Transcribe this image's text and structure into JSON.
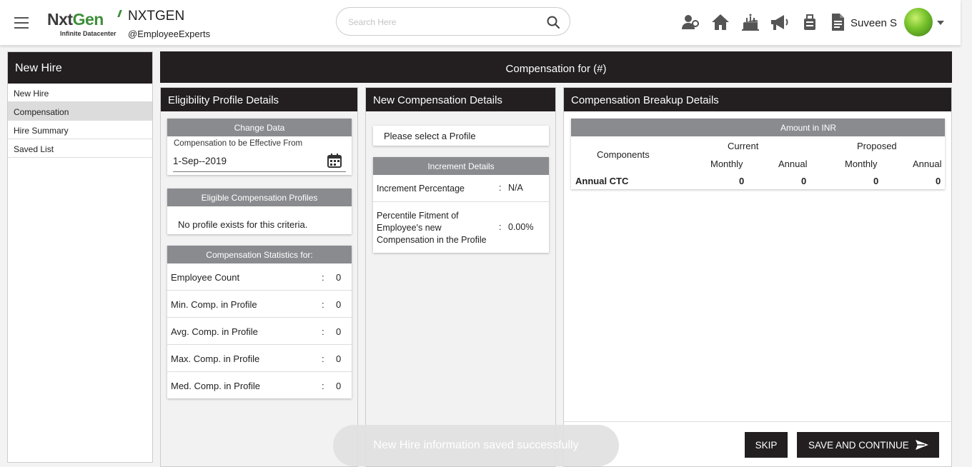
{
  "header": {
    "brand_main": "NxtGen",
    "brand_sub": "Infinite Datacenter",
    "company": "NXTGEN",
    "handle": "@EmployeeExperts",
    "search_placeholder": "Search Here",
    "username": "Suveen S"
  },
  "sidebar": {
    "title": "New Hire",
    "items": [
      {
        "label": "New Hire",
        "active": false
      },
      {
        "label": "Compensation",
        "active": true
      },
      {
        "label": "Hire Summary",
        "active": false
      },
      {
        "label": "Saved List",
        "active": false
      }
    ]
  },
  "main": {
    "title": "Compensation for (#)"
  },
  "eligibility": {
    "title": "Eligibility Profile Details",
    "change_data": {
      "header": "Change Data",
      "label": "Compensation to be Effective From",
      "date": "1-Sep--2019"
    },
    "profiles": {
      "header": "Eligible Compensation Profiles",
      "message": "No profile exists for this criteria."
    },
    "stats": {
      "header": "Compensation Statistics for:",
      "rows": [
        {
          "label": "Employee Count",
          "value": "0"
        },
        {
          "label": "Min. Comp. in Profile",
          "value": "0"
        },
        {
          "label": "Avg. Comp. in Profile",
          "value": "0"
        },
        {
          "label": "Max. Comp. in Profile",
          "value": "0"
        },
        {
          "label": "Med. Comp. in Profile",
          "value": "0"
        }
      ]
    }
  },
  "new_comp": {
    "title": "New Compensation Details",
    "profile_prompt": "Please select a Profile",
    "increment": {
      "header": "Increment Details",
      "rows": [
        {
          "label": "Increment Percentage",
          "value": "N/A"
        },
        {
          "label": "Percentile Fitment of Employee's new Compensation in the Profile",
          "value": "0.00%"
        }
      ],
      "row2_lines": [
        "Percentile Fitment of",
        "Employee's new",
        "Compensation in the Profile"
      ]
    }
  },
  "breakup": {
    "title": "Compensation Breakup Details",
    "amount_header": "Amount in INR",
    "components_label": "Components",
    "current_label": "Current",
    "proposed_label": "Proposed",
    "monthly_label": "Monthly",
    "annual_label": "Annual",
    "rows": [
      {
        "name": "Annual CTC",
        "current_monthly": "0",
        "current_annual": "0",
        "proposed_monthly": "0",
        "proposed_annual": "0"
      }
    ]
  },
  "actions": {
    "skip": "SKIP",
    "save": "SAVE AND CONTINUE"
  },
  "toast": "New Hire information saved successfully",
  "colors": {
    "dark": "#231f20",
    "subheader_gray": "#8a8b8f",
    "brand_green": "#3d8f3a"
  },
  "icons": [
    "hamburger-icon",
    "search-icon",
    "team-icon",
    "home-icon",
    "birthday-cake-icon",
    "megaphone-icon",
    "luggage-icon",
    "document-icon",
    "calendar-icon",
    "send-arrow-icon"
  ]
}
